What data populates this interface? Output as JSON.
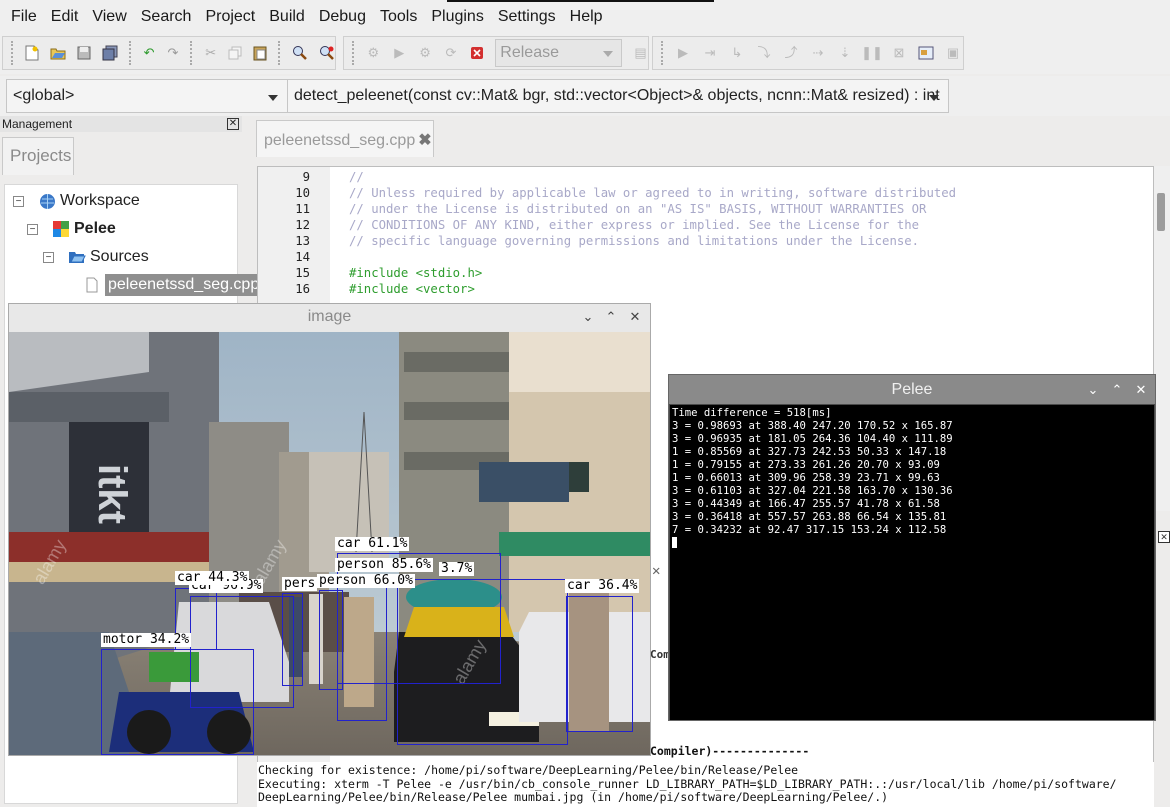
{
  "menu": [
    "File",
    "Edit",
    "View",
    "Search",
    "Project",
    "Build",
    "Debug",
    "Tools",
    "Plugins",
    "Settings",
    "Help"
  ],
  "toolbar": {
    "build_target": "Release"
  },
  "scope": {
    "global": "<global>",
    "function": "detect_peleenet(const cv::Mat& bgr, std::vector<Object>& objects, ncnn::Mat& resized) : int"
  },
  "management": {
    "title": "Management",
    "tab": "Projects",
    "tree": {
      "workspace": "Workspace",
      "project": "Pelee",
      "folder": "Sources",
      "file": "peleenetssd_seg.cpp"
    }
  },
  "editor": {
    "tab": "peleenetssd_seg.cpp",
    "lines": [
      {
        "n": "9",
        "text": "//",
        "kind": "comment"
      },
      {
        "n": "10",
        "text": "// Unless required by applicable law or agreed to in writing, software distributed",
        "kind": "comment"
      },
      {
        "n": "11",
        "text": "// under the License is distributed on an \"AS IS\" BASIS, WITHOUT WARRANTIES OR",
        "kind": "comment"
      },
      {
        "n": "12",
        "text": "// CONDITIONS OF ANY KIND, either express or implied. See the License for the",
        "kind": "comment"
      },
      {
        "n": "13",
        "text": "// specific language governing permissions and limitations under the License.",
        "kind": "comment"
      },
      {
        "n": "14",
        "text": "",
        "kind": "plain"
      },
      {
        "n": "15",
        "text": "#include <stdio.h>",
        "kind": "pre"
      },
      {
        "n": "16",
        "text": "#include <vector>",
        "kind": "pre"
      }
    ]
  },
  "log": {
    "compiler_tail": "Compiler)--------------",
    "lines": [
      "Checking for existence: /home/pi/software/DeepLearning/Pelee/bin/Release/Pelee",
      "Executing: xterm -T Pelee -e /usr/bin/cb_console_runner LD_LIBRARY_PATH=$LD_LIBRARY_PATH:.:/usr/local/lib /home/pi/software/",
      "DeepLearning/Pelee/bin/Release/Pelee mumbai.jpg (in /home/pi/software/DeepLearning/Pelee/.)"
    ]
  },
  "image_window": {
    "title": "image",
    "detections": [
      "car 61.1%",
      "person 85.6%",
      "person 66.0%",
      "car 44.3%",
      "car 36.4%",
      "motor 34.2%",
      "car 96.9%",
      "pers",
      "3.7%"
    ]
  },
  "pelee_window": {
    "title": "Pelee",
    "lines": [
      "Time difference = 518[ms]",
      "3 = 0.98693 at 388.40 247.20 170.52 x 165.87",
      "3 = 0.96935 at 181.05 264.36 104.40 x 111.89",
      "1 = 0.85569 at 327.73 242.53 50.33 x 147.18",
      "1 = 0.79155 at 273.33 261.26 20.70 x 93.09",
      "1 = 0.66013 at 309.96 258.39 23.71 x 99.63",
      "3 = 0.61103 at 327.04 221.58 163.70 x 130.36",
      "3 = 0.44349 at 166.47 255.57 41.78 x 61.58",
      "3 = 0.36418 at 557.57 263.88 66.54 x 135.81",
      "7 = 0.34232 at 92.47 317.15 153.24 x 112.58"
    ]
  },
  "colors": {
    "comment": "#a8a8c8",
    "preprocessor": "#2e9d2e",
    "detection_box": "#2222cc"
  }
}
